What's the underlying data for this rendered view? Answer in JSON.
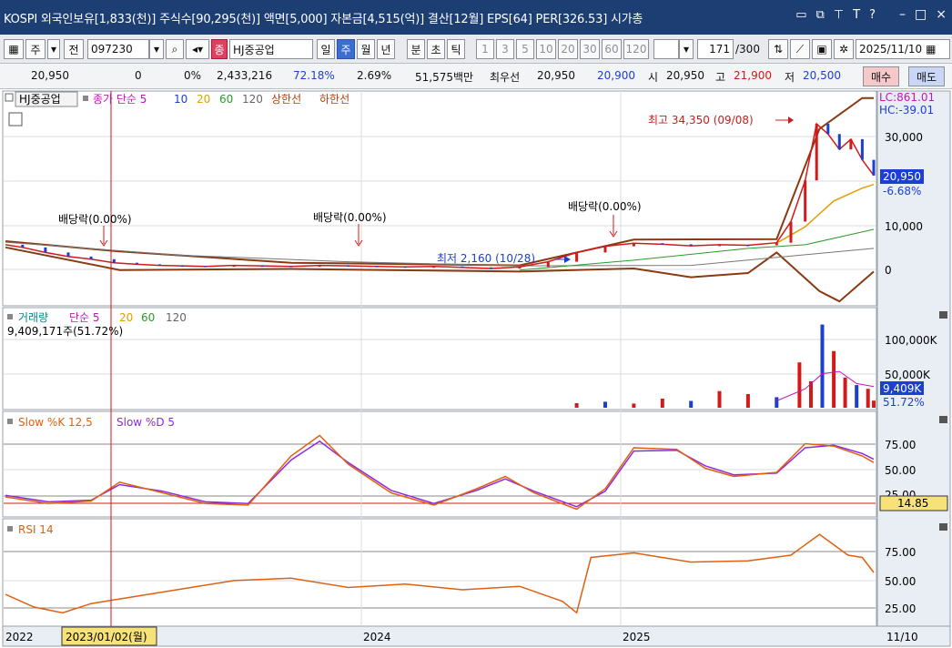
{
  "window": {
    "title": "KOSPI 외국인보유[1,833(천)] 주식수[90,295(천)] 액면[5,000] 자본금[4,515(억)] 결산[12월] EPS[64] PER[326.53] 시가총",
    "min": "–",
    "max": "□",
    "close": "×",
    "help": "?"
  },
  "toolbar": {
    "code": "097230",
    "market_badge": "종",
    "stock_name": "HJ중공업",
    "label_main": "주",
    "label_prev": "전",
    "periods": [
      "일",
      "주",
      "월",
      "년",
      "분",
      "초",
      "틱"
    ],
    "selected_period": "주",
    "intervals": [
      "1",
      "3",
      "5",
      "10",
      "20",
      "30",
      "60",
      "120"
    ],
    "count": "171",
    "count_max": "/300",
    "date": "2025/11/10"
  },
  "quote": {
    "price": "20,950",
    "change": "0",
    "change_pct": "0%",
    "volume": "2,433,216",
    "vol_pct": "72.18%",
    "turnover": "2.69%",
    "amount": "51,575백만",
    "best_label": "최우선",
    "best_ask": "20,950",
    "best_bid": "20,900",
    "open_label": "시",
    "open": "20,950",
    "high_label": "고",
    "high": "21,900",
    "low_label": "저",
    "low": "20,500",
    "buy": "매수",
    "sell": "매도"
  },
  "legends": {
    "price": {
      "name": "HJ중공업",
      "ma": "종가 단순 5",
      "p10": "10",
      "p20": "20",
      "p60": "60",
      "p120": "120",
      "upper": "상한선",
      "lower": "하한선"
    },
    "volume": {
      "name": "거래량",
      "ma": "단순 5",
      "p20": "20",
      "p60": "60",
      "p120": "120",
      "info": "9,409,171주(51.72%)"
    },
    "stoch": {
      "k": "Slow %K 12,5",
      "d": "Slow %D 5"
    },
    "rsi": {
      "name": "RSI 14"
    }
  },
  "annotations": {
    "high": "최고 34,350 (09/08)",
    "low": "최저 2,160 (10/28)",
    "dividends": [
      "배당락(0.00%)",
      "배당락(0.00%)",
      "배당락(0.00%)"
    ]
  },
  "axes": {
    "lc": "LC:861.01",
    "hc": "HC:-39.01",
    "price_ticks": [
      "30,000",
      "10,000",
      "0"
    ],
    "price_now": "20,950",
    "price_pct": "-6.68%",
    "volume_ticks": [
      "100,000K",
      "50,000K"
    ],
    "volume_now": "9,409K",
    "volume_pct": "51.72%",
    "stoch_ticks": [
      "75.00",
      "50.00",
      "25.00"
    ],
    "stoch_now": "14.85",
    "rsi_ticks": [
      "75.00",
      "50.00",
      "25.00"
    ],
    "x_labels": [
      "2022",
      "2024",
      "2025"
    ],
    "cursor_date": "2023/01/02(월)",
    "right_date": "11/10"
  },
  "chart_data": {
    "type": "line",
    "y_axis_ticks": [
      0,
      10000,
      30000
    ],
    "price_close_path": [
      [
        0,
        7500
      ],
      [
        6,
        7000
      ],
      [
        14,
        6000
      ],
      [
        22,
        5200
      ],
      [
        30,
        4700
      ],
      [
        38,
        4000
      ],
      [
        46,
        3700
      ],
      [
        54,
        3500
      ],
      [
        62,
        3400
      ],
      [
        70,
        3300
      ],
      [
        80,
        3500
      ],
      [
        90,
        3400
      ],
      [
        100,
        3300
      ],
      [
        110,
        3500
      ],
      [
        120,
        3400
      ],
      [
        130,
        3300
      ],
      [
        140,
        3200
      ],
      [
        150,
        3300
      ],
      [
        160,
        3100
      ],
      [
        170,
        2900
      ],
      [
        180,
        3200
      ],
      [
        190,
        4200
      ],
      [
        200,
        6000
      ],
      [
        210,
        7200
      ],
      [
        220,
        7800
      ],
      [
        230,
        7600
      ],
      [
        240,
        7300
      ],
      [
        250,
        7500
      ],
      [
        260,
        7400
      ],
      [
        270,
        7900
      ],
      [
        275,
        12000
      ],
      [
        280,
        20000
      ],
      [
        284,
        31000
      ],
      [
        288,
        29000
      ],
      [
        292,
        26000
      ],
      [
        296,
        28000
      ],
      [
        300,
        24000
      ],
      [
        304,
        20950
      ]
    ],
    "ma20_path": [
      [
        270,
        7800
      ],
      [
        280,
        11000
      ],
      [
        290,
        16000
      ],
      [
        300,
        18500
      ],
      [
        304,
        19200
      ]
    ],
    "ma60_path": [
      [
        180,
        2600
      ],
      [
        220,
        4500
      ],
      [
        260,
        6800
      ],
      [
        280,
        7500
      ],
      [
        304,
        10500
      ]
    ],
    "ma120_path": [
      [
        0,
        8000
      ],
      [
        60,
        5500
      ],
      [
        120,
        4200
      ],
      [
        180,
        3400
      ],
      [
        240,
        3500
      ],
      [
        304,
        6800
      ]
    ],
    "bb_upper_path": [
      [
        0,
        8200
      ],
      [
        40,
        6200
      ],
      [
        100,
        4000
      ],
      [
        180,
        3500
      ],
      [
        220,
        8500
      ],
      [
        270,
        8600
      ],
      [
        285,
        30000
      ],
      [
        300,
        36000
      ],
      [
        304,
        36000
      ]
    ],
    "bb_lower_path": [
      [
        0,
        7000
      ],
      [
        40,
        2600
      ],
      [
        100,
        2800
      ],
      [
        180,
        2300
      ],
      [
        220,
        2900
      ],
      [
        240,
        1200
      ],
      [
        260,
        2000
      ],
      [
        270,
        6000
      ],
      [
        285,
        -1500
      ],
      [
        292,
        -3500
      ],
      [
        304,
        2300
      ]
    ],
    "volume_bars_k": [
      [
        200,
        6000
      ],
      [
        210,
        8000
      ],
      [
        220,
        5500
      ],
      [
        230,
        12000
      ],
      [
        240,
        9000
      ],
      [
        250,
        22000
      ],
      [
        260,
        18000
      ],
      [
        270,
        14000
      ],
      [
        278,
        60000
      ],
      [
        282,
        35000
      ],
      [
        286,
        110000
      ],
      [
        290,
        75000
      ],
      [
        294,
        40000
      ],
      [
        298,
        30000
      ],
      [
        302,
        25000
      ],
      [
        304,
        9409
      ]
    ],
    "volume_ma5_path_k": [
      [
        270,
        9000
      ],
      [
        280,
        25000
      ],
      [
        286,
        45000
      ],
      [
        292,
        48000
      ],
      [
        298,
        32000
      ],
      [
        304,
        28000
      ]
    ],
    "stoch_k_path": [
      [
        0,
        20
      ],
      [
        15,
        12
      ],
      [
        30,
        15
      ],
      [
        40,
        38
      ],
      [
        55,
        25
      ],
      [
        70,
        12
      ],
      [
        85,
        10
      ],
      [
        100,
        70
      ],
      [
        110,
        95
      ],
      [
        120,
        60
      ],
      [
        135,
        25
      ],
      [
        150,
        10
      ],
      [
        165,
        30
      ],
      [
        175,
        45
      ],
      [
        185,
        25
      ],
      [
        200,
        5
      ],
      [
        210,
        30
      ],
      [
        220,
        80
      ],
      [
        235,
        78
      ],
      [
        245,
        55
      ],
      [
        255,
        45
      ],
      [
        270,
        50
      ],
      [
        280,
        85
      ],
      [
        290,
        82
      ],
      [
        300,
        70
      ],
      [
        304,
        62
      ]
    ],
    "stoch_d_path": [
      [
        0,
        22
      ],
      [
        15,
        14
      ],
      [
        30,
        16
      ],
      [
        40,
        35
      ],
      [
        55,
        27
      ],
      [
        70,
        14
      ],
      [
        85,
        12
      ],
      [
        100,
        65
      ],
      [
        110,
        88
      ],
      [
        120,
        62
      ],
      [
        135,
        28
      ],
      [
        150,
        12
      ],
      [
        165,
        28
      ],
      [
        175,
        42
      ],
      [
        185,
        27
      ],
      [
        200,
        8
      ],
      [
        210,
        27
      ],
      [
        220,
        76
      ],
      [
        235,
        77
      ],
      [
        245,
        58
      ],
      [
        255,
        47
      ],
      [
        270,
        49
      ],
      [
        280,
        80
      ],
      [
        290,
        83
      ],
      [
        300,
        73
      ],
      [
        304,
        66
      ]
    ],
    "rsi_path": [
      [
        0,
        36
      ],
      [
        10,
        25
      ],
      [
        20,
        20
      ],
      [
        30,
        28
      ],
      [
        40,
        32
      ],
      [
        60,
        40
      ],
      [
        80,
        48
      ],
      [
        100,
        50
      ],
      [
        120,
        42
      ],
      [
        140,
        45
      ],
      [
        160,
        40
      ],
      [
        180,
        43
      ],
      [
        195,
        30
      ],
      [
        200,
        20
      ],
      [
        205,
        68
      ],
      [
        220,
        72
      ],
      [
        240,
        64
      ],
      [
        260,
        65
      ],
      [
        275,
        70
      ],
      [
        285,
        88
      ],
      [
        295,
        70
      ],
      [
        300,
        68
      ],
      [
        304,
        55
      ]
    ],
    "ylim_price": [
      -4000,
      37000
    ],
    "ylim_volume_k": [
      0,
      130000
    ],
    "ylim_stoch": [
      0,
      100
    ],
    "ylim_rsi": [
      10,
      100
    ]
  }
}
